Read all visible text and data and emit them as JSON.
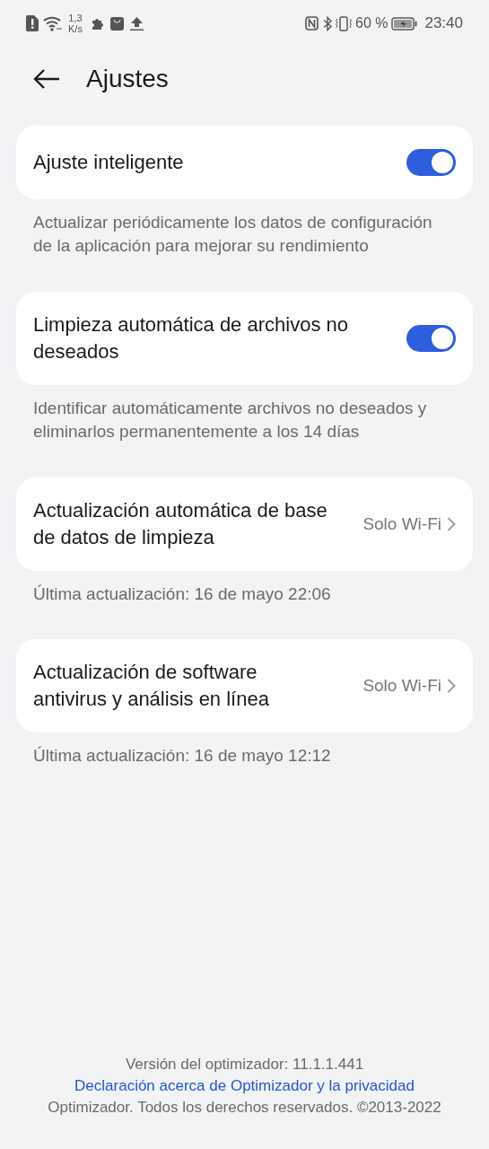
{
  "status_bar": {
    "speed_value": "1,3",
    "speed_unit": "K/s",
    "battery": "60 %",
    "time": "23:40"
  },
  "header": {
    "title": "Ajustes"
  },
  "settings": [
    {
      "kind": "toggle",
      "label": "Ajuste inteligente",
      "on": true,
      "note": "Actualizar periódicamente los datos de configuración de la aplicación para mejorar su rendimiento"
    },
    {
      "kind": "toggle",
      "label": "Limpieza automática de archivos no deseados",
      "on": true,
      "note": "Identificar automáticamente archivos no deseados y eliminarlos permanentemente a los 14 días"
    },
    {
      "kind": "link",
      "label": "Actualización automática de base de datos de limpieza",
      "value": "Solo Wi-Fi",
      "note": "Última actualización: 16 de mayo 22:06"
    },
    {
      "kind": "link",
      "label": "Actualización de software antivirus y análisis en línea",
      "value": "Solo Wi-Fi",
      "note": "Última actualización: 16 de mayo 12:12"
    }
  ],
  "footer": {
    "version": "Versión del optimizador: 11.1.1.441",
    "privacy_link": "Declaración acerca de Optimizador y la privacidad",
    "copyright": "Optimizador. Todos los derechos reservados. ©2013-2022"
  }
}
